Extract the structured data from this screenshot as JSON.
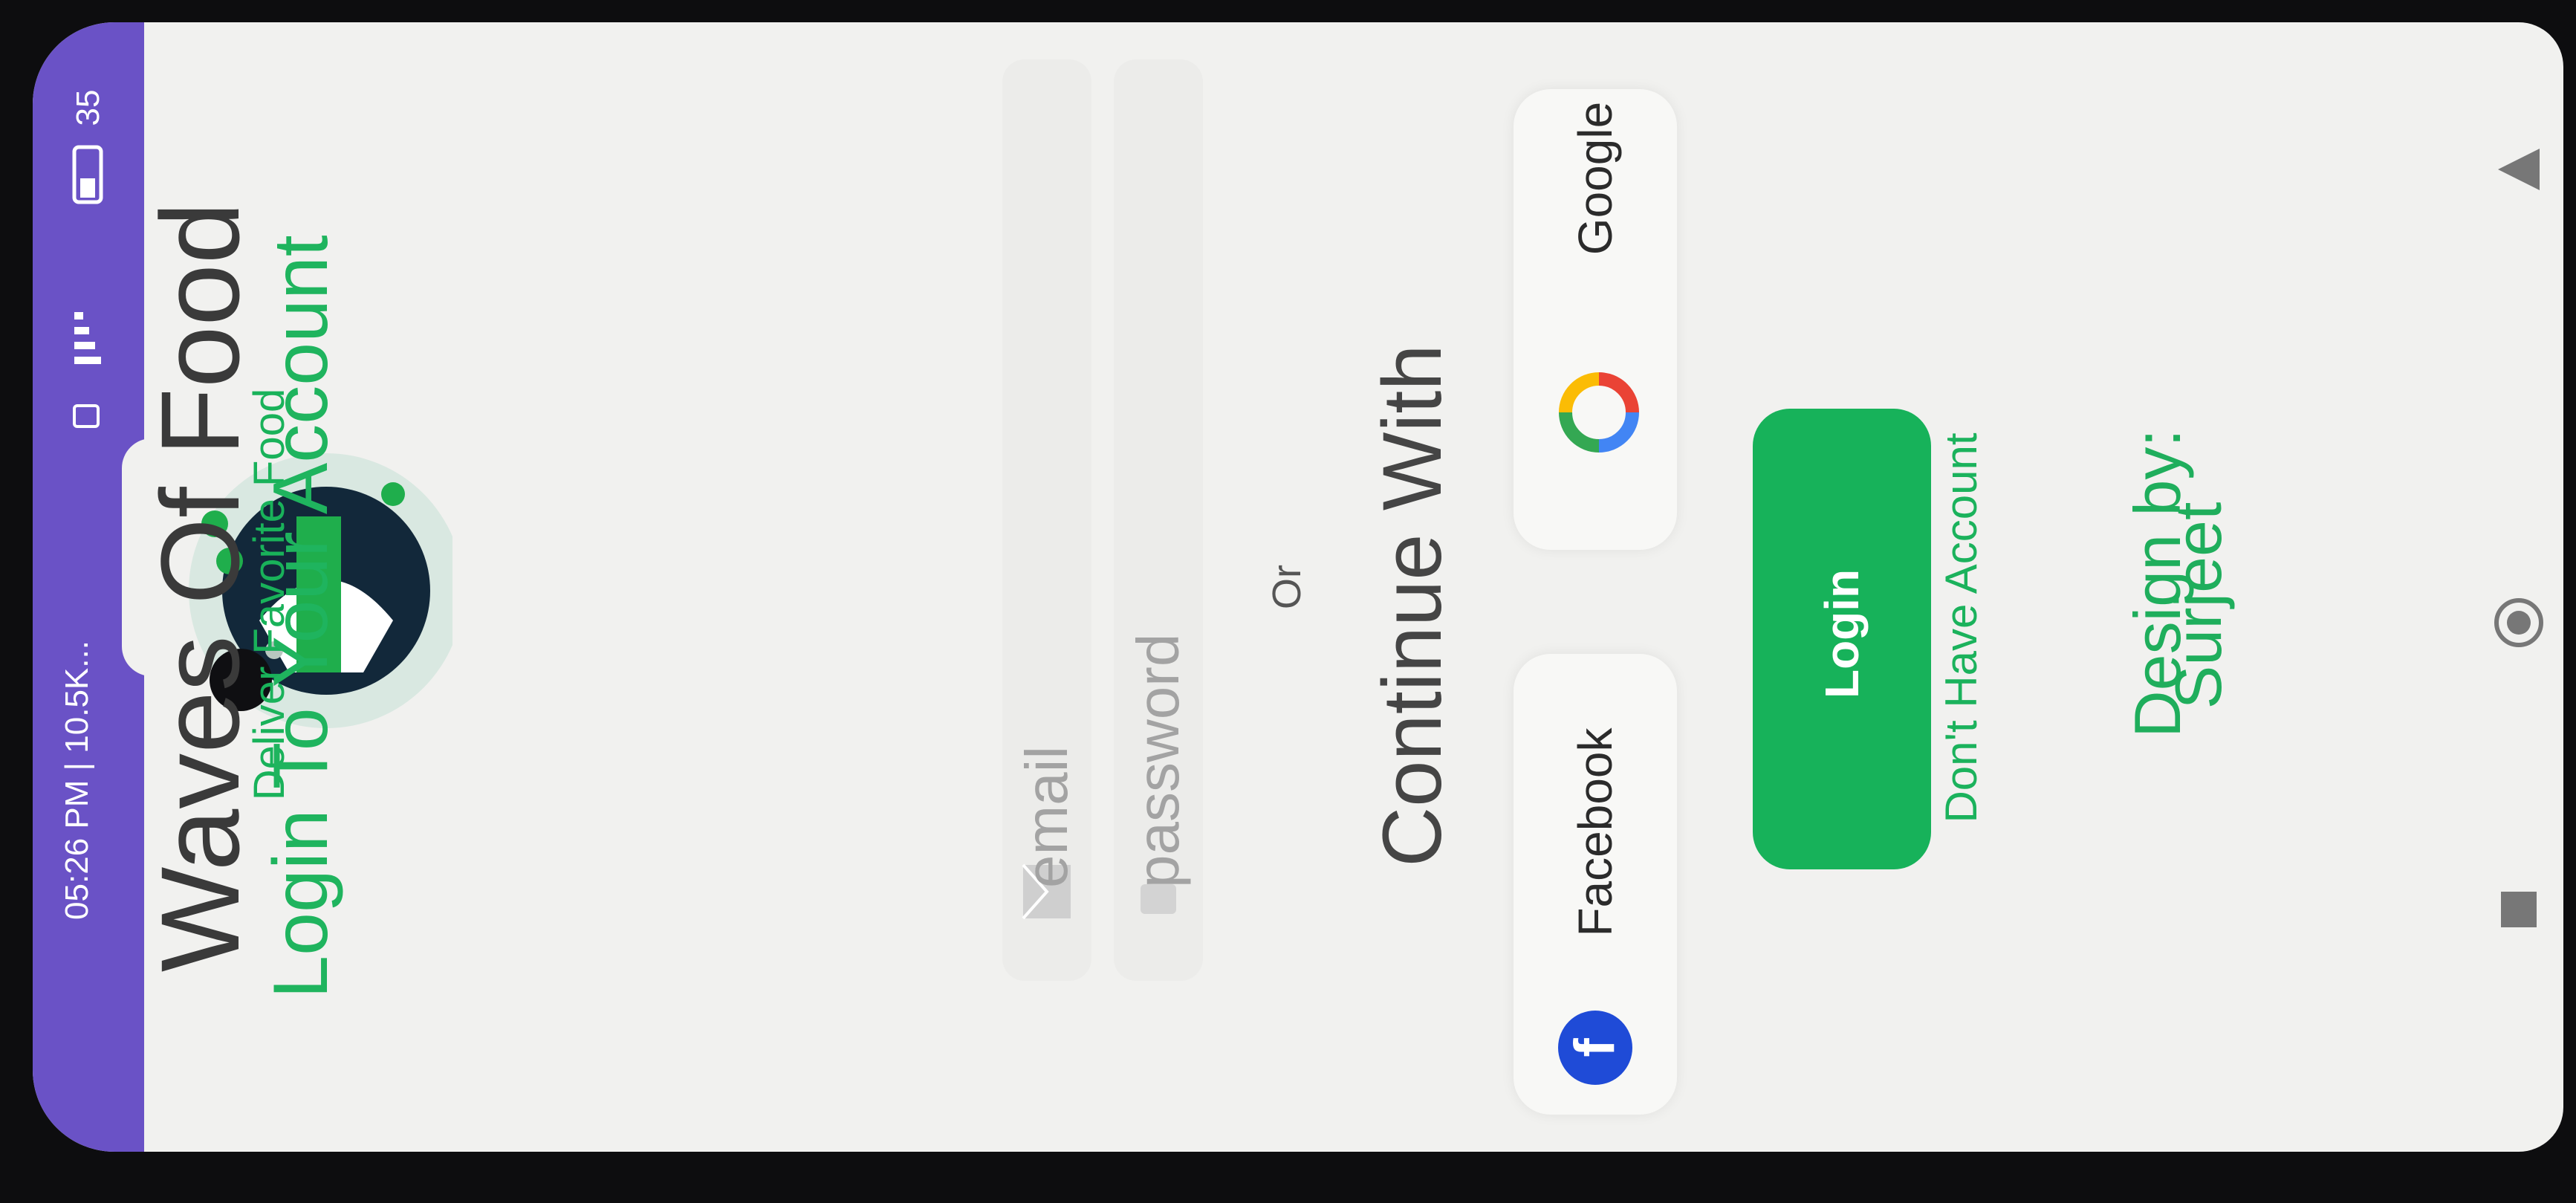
{
  "status_bar": {
    "time_and_speed": "05:26 PM | 10.5K...",
    "battery": "35"
  },
  "app": {
    "title": "Waves Of Food",
    "tagline": "Deliver Favorite Food"
  },
  "login": {
    "headline": "Login To Your Account",
    "email_placeholder": "email",
    "password_placeholder": "password",
    "or_label": "Or",
    "continue_with": "Continue With",
    "facebook_label": "Facebook",
    "google_label": "Google",
    "login_button": "Login",
    "signup_link": "Don't Have Account"
  },
  "credit": {
    "line1": "Design by:",
    "line2": "Surjeet"
  },
  "colors": {
    "accent": "#17b25a",
    "status_bar": "#6a52c6",
    "background": "#f1f1ef",
    "facebook": "#1f4bd7"
  }
}
